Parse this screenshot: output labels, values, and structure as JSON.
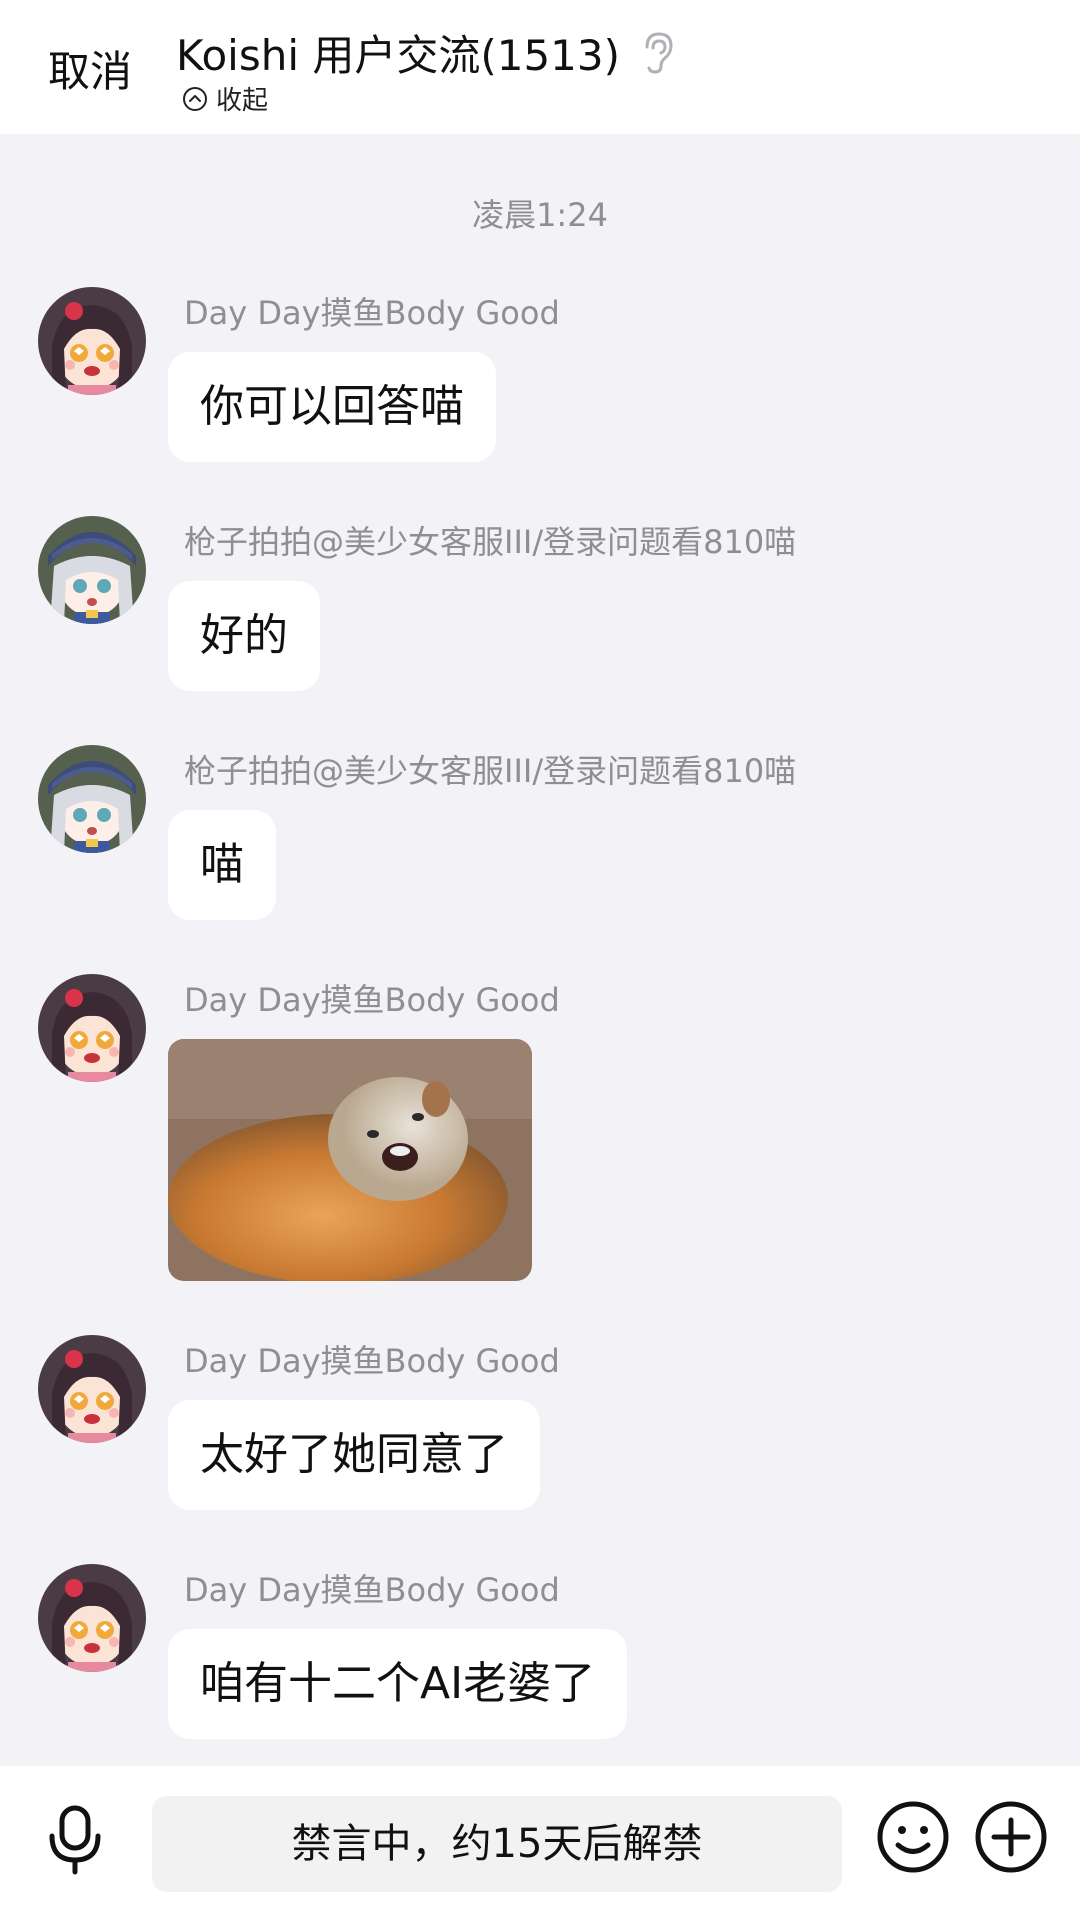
{
  "header": {
    "cancel_label": "取消",
    "title": "Koishi 用户交流(1513)",
    "collapse_label": "收起"
  },
  "timestamp": "凌晨1:24",
  "messages": [
    {
      "sender": "Day Day摸鱼Body Good",
      "text": "你可以回答喵",
      "avatar": "brown-hair-anime-girl-avatar"
    },
    {
      "sender": "枪子拍拍@美少女客服III/登录问题看810喵",
      "text": "好的",
      "avatar": "silver-hair-anime-girl-avatar"
    },
    {
      "sender": "枪子拍拍@美少女客服III/登录问题看810喵",
      "text": "喵",
      "avatar": "silver-hair-anime-girl-avatar"
    },
    {
      "sender": "Day Day摸鱼Body Good",
      "image": "fox-photo",
      "avatar": "brown-hair-anime-girl-avatar"
    },
    {
      "sender": "Day Day摸鱼Body Good",
      "text": "太好了她同意了",
      "avatar": "brown-hair-anime-girl-avatar"
    },
    {
      "sender": "Day Day摸鱼Body Good",
      "text": "咱有十二个AI老婆了",
      "avatar": "brown-hair-anime-girl-avatar"
    }
  ],
  "input": {
    "muted_text": "禁言中，约15天后解禁"
  },
  "icons": {
    "voice": "mic-icon",
    "emoji": "smiley-icon",
    "more": "plus-circle-icon",
    "listen": "ear-icon",
    "collapse": "chevron-up-circle-icon"
  }
}
